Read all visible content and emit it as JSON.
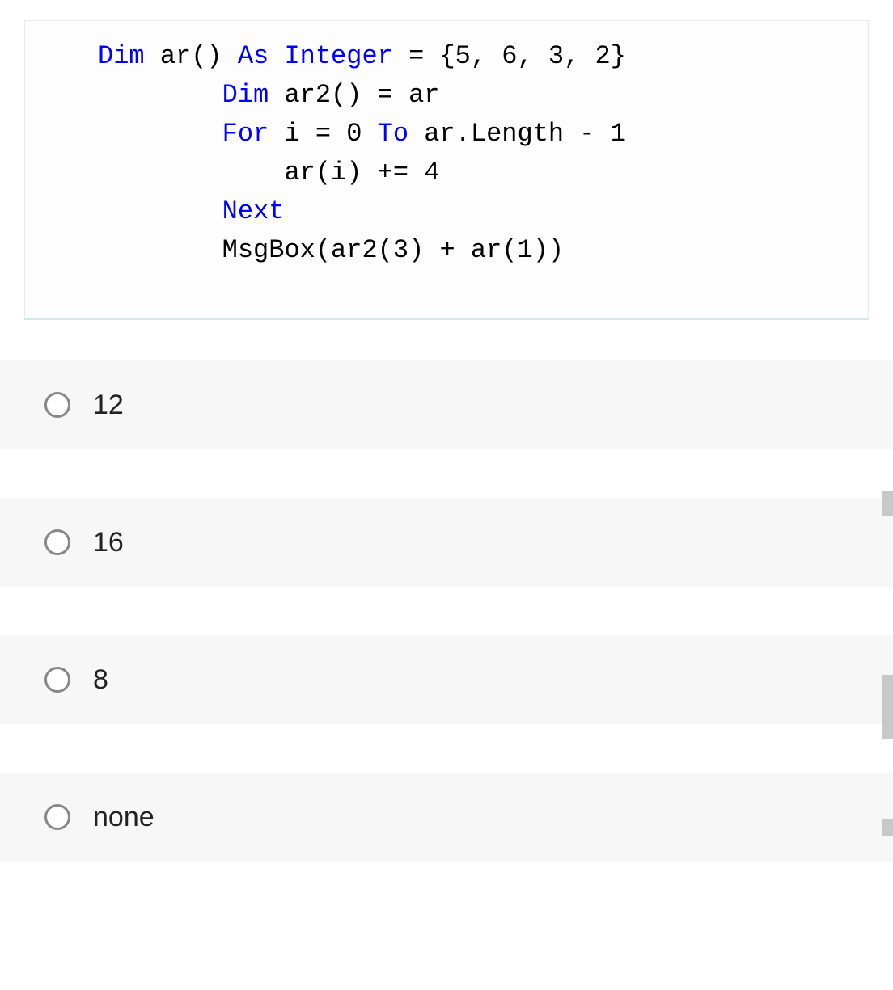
{
  "code": {
    "line1": {
      "t1": "Dim",
      "t2": " ar() ",
      "t3": "As",
      "t4": " ",
      "t5": "Integer",
      "t6": " = {5, 6, 3, 2}"
    },
    "line2": {
      "t1": "Dim",
      "t2": " ar2() = ar"
    },
    "line3": {
      "t1": "For",
      "t2": " i = 0 ",
      "t3": "To",
      "t4": " ar.Length - 1"
    },
    "line4": {
      "t1": "ar(i) += 4"
    },
    "line5": {
      "t1": "Next"
    },
    "line6": {
      "t1": "MsgBox(ar2(3) + ar(1))"
    }
  },
  "options": [
    {
      "label": "12"
    },
    {
      "label": "16"
    },
    {
      "label": "8"
    },
    {
      "label": "none"
    }
  ]
}
